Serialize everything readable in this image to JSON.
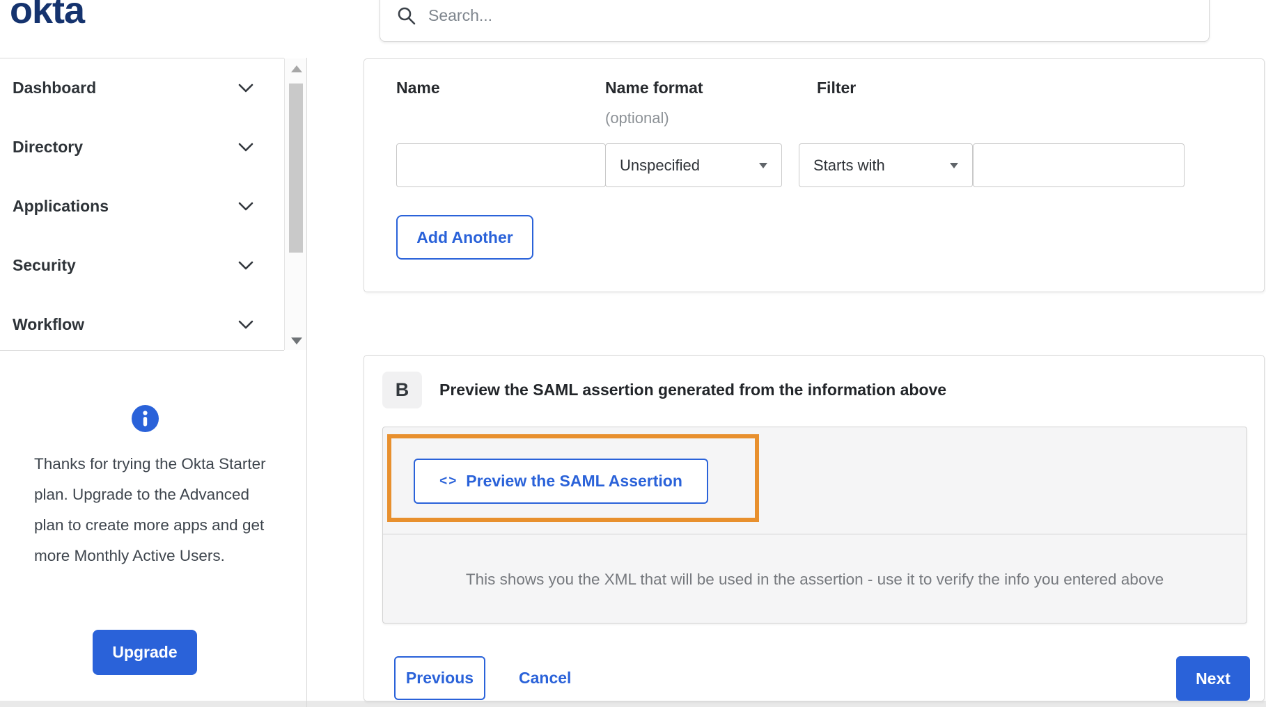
{
  "brand": {
    "logo_text": "okta"
  },
  "header": {
    "search_placeholder": "Search..."
  },
  "sidebar": {
    "items": [
      {
        "label": "Dashboard"
      },
      {
        "label": "Directory"
      },
      {
        "label": "Applications"
      },
      {
        "label": "Security"
      },
      {
        "label": "Workflow"
      }
    ],
    "upsell_text": "Thanks for trying the Okta Starter plan. Upgrade to the Advanced plan to create more apps and get more Monthly Active Users.",
    "upgrade_label": "Upgrade"
  },
  "attribute_form": {
    "name_label": "Name",
    "name_format_label": "Name format",
    "name_format_hint": "(optional)",
    "filter_label": "Filter",
    "name_value": "",
    "name_format_value": "Unspecified",
    "filter_type_value": "Starts with",
    "filter_value": "",
    "add_another_label": "Add Another"
  },
  "preview_section": {
    "step_badge": "B",
    "heading": "Preview the SAML assertion generated from the information above",
    "code_icon_glyph": "<>",
    "preview_button_label": "Preview the SAML Assertion",
    "description": "This shows you the XML that will be used in the assertion - use it to verify the info you entered above"
  },
  "wizard_footer": {
    "previous_label": "Previous",
    "cancel_label": "Cancel",
    "next_label": "Next"
  },
  "colors": {
    "primary_blue": "#2a62d9",
    "brand_navy": "#15336e",
    "highlight_orange": "#e8902e"
  }
}
